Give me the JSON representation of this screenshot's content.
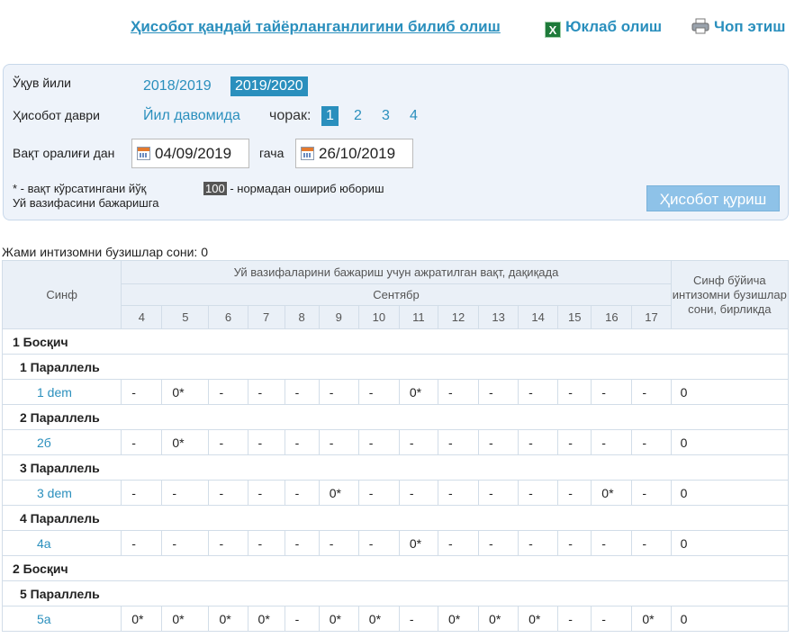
{
  "top_links": {
    "help": "Ҳисобот қандай тайёрланганлигини билиб олиш",
    "download": "Юклаб олиш",
    "print": "Чоп этиш"
  },
  "filters": {
    "year_label": "Ўқув йили",
    "years": [
      "2018/2019",
      "2019/2020"
    ],
    "active_year": "2019/2020",
    "period_label": "Ҳисобот даври",
    "period_option": "Йил давомида",
    "quarter_label": "чорак:",
    "quarters": [
      "1",
      "2",
      "3",
      "4"
    ],
    "active_quarter": "1",
    "range_label_from": "Вақт оралиғи дан",
    "date_from": "04/09/2019",
    "range_label_to": "гача",
    "date_to": "26/10/2019",
    "note_line1": "* - вақт кўрсатингани йўқ",
    "note_line2": "Уй вазифасини бажаришга",
    "badge": "100",
    "badge_note": "- нормадан ошириб юбориш",
    "build_button": "Ҳисобот қуриш"
  },
  "summary": {
    "total_label": "Жами интизомни бузишлар сони: 0"
  },
  "table": {
    "col_class": "Синф",
    "col_group": "Уй вазифаларини бажариш учун ажратилган вақт, дақиқада",
    "month": "Сентябр",
    "days": [
      "4",
      "5",
      "6",
      "7",
      "8",
      "9",
      "10",
      "11",
      "12",
      "13",
      "14",
      "15",
      "16",
      "17"
    ],
    "col_total": "Синф бўйича интизомни бузишлар сони, бирликда",
    "rows": [
      {
        "type": "stage",
        "label": "1 Босқич"
      },
      {
        "type": "parallel",
        "label": "1 Параллель"
      },
      {
        "type": "class",
        "name": "1 dem",
        "cells": [
          "-",
          "0*",
          "-",
          "-",
          "-",
          "-",
          "-",
          "0*",
          "-",
          "-",
          "-",
          "-",
          "-",
          "-"
        ],
        "total": "0"
      },
      {
        "type": "parallel",
        "label": "2 Параллель"
      },
      {
        "type": "class",
        "name": "2б",
        "cells": [
          "-",
          "0*",
          "-",
          "-",
          "-",
          "-",
          "-",
          "-",
          "-",
          "-",
          "-",
          "-",
          "-",
          "-"
        ],
        "total": "0"
      },
      {
        "type": "parallel",
        "label": "3 Параллель"
      },
      {
        "type": "class",
        "name": "3 dem",
        "cells": [
          "-",
          "-",
          "-",
          "-",
          "-",
          "0*",
          "-",
          "-",
          "-",
          "-",
          "-",
          "-",
          "0*",
          "-"
        ],
        "total": "0"
      },
      {
        "type": "parallel",
        "label": "4 Параллель"
      },
      {
        "type": "class",
        "name": "4а",
        "cells": [
          "-",
          "-",
          "-",
          "-",
          "-",
          "-",
          "-",
          "0*",
          "-",
          "-",
          "-",
          "-",
          "-",
          "-"
        ],
        "total": "0"
      },
      {
        "type": "stage",
        "label": "2 Босқич"
      },
      {
        "type": "parallel",
        "label": "5 Параллель"
      },
      {
        "type": "class",
        "name": "5а",
        "cells": [
          "0*",
          "0*",
          "0*",
          "0*",
          "-",
          "0*",
          "0*",
          "-",
          "0*",
          "0*",
          "0*",
          "-",
          "-",
          "0*"
        ],
        "total": "0"
      }
    ]
  }
}
